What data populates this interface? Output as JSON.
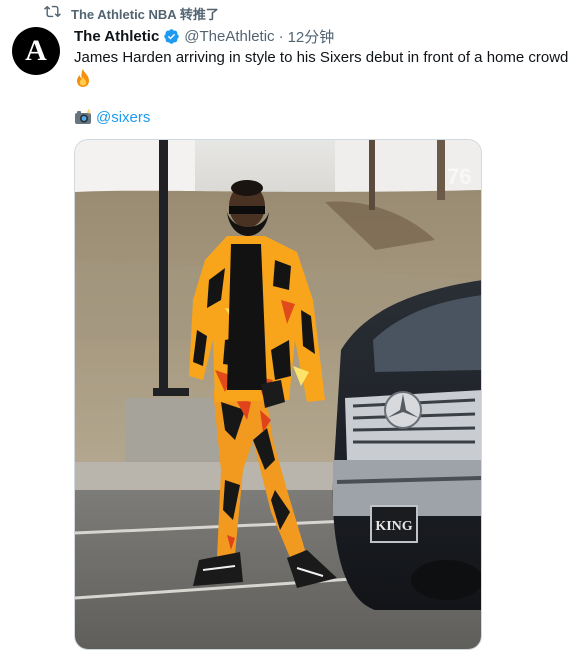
{
  "retweet": {
    "icon": "retweet-icon",
    "label": "The Athletic NBA 转推了"
  },
  "tweet": {
    "avatar_letter": "A",
    "display_name": "The Athletic",
    "verified_icon": "verified-badge-icon",
    "handle": "@TheAthletic",
    "separator": "·",
    "time": "12分钟",
    "text": "James Harden arriving in style to his Sixers debut in front of a home crowd",
    "text_emoji_icon": "fire-icon",
    "mention_emoji_icon": "camera-flash-icon",
    "mention": "@sixers",
    "media": {
      "icon": "photo",
      "watermark": "76",
      "plate_text": "KING"
    }
  },
  "colors": {
    "link": "#1d9bf0",
    "secondary_text": "#536471",
    "primary_text": "#0f1419",
    "verified": "#1d9bf0"
  }
}
